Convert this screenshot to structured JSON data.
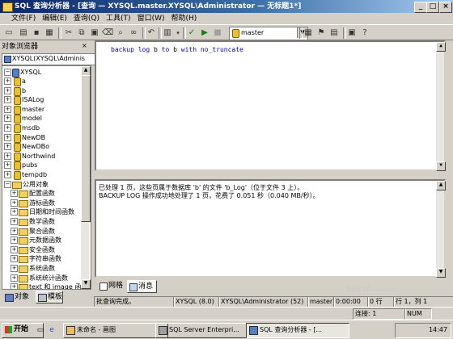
{
  "window": {
    "title": "SQL 查询分析器 - [查询 — XYSQL.master.XYSQL\\Administrator — 无标题1*]"
  },
  "menu": [
    "文件(F)",
    "编辑(E)",
    "查询(Q)",
    "工具(T)",
    "窗口(W)",
    "帮助(H)"
  ],
  "toolbar": {
    "database": "master"
  },
  "object_browser": {
    "title": "对象浏览器",
    "server_selector": "XYSQL(XYSQL\\Adminis",
    "server": "XYSQL",
    "databases": [
      "a",
      "b",
      "ISALog",
      "master",
      "model",
      "msdb",
      "NewDB",
      "NewDBo",
      "Northwind",
      "pubs",
      "tempdb"
    ],
    "functions_folder": "公用对象",
    "function_groups": [
      "配置函数",
      "游标函数",
      "日期和时间函数",
      "数学函数",
      "聚合函数",
      "元数据函数",
      "安全函数",
      "字符串函数",
      "系统函数",
      "系统统计函数",
      "text 和 image 函"
    ],
    "tabs": [
      "对象",
      "模板"
    ]
  },
  "editor": {
    "sql": "backup log b to b with no_truncate"
  },
  "results": {
    "messages": [
      "已处理 1 页，这些页属于数据库 'b' 的文件 'b_Log'（位于文件 3 上）。",
      "BACKUP LOG 操作成功地处理了 1 页，花费了 0.051 秒（0.040 MB/秒）。"
    ],
    "tabs": [
      "网格",
      "消息"
    ]
  },
  "statusbar": {
    "message": "批查询完成。",
    "server": "XYSQL (8.0)",
    "user": "XYSQL\\Administrator (52)",
    "database": "master",
    "time": "0:00:00",
    "rows": "0 行",
    "position": "行 1，列 1"
  },
  "bottom_strip": {
    "conn": "连接: 1",
    "mode": "NUM"
  },
  "taskbar": {
    "start": "开始",
    "tasks": [
      "未命名 - 画图",
      "SQL Server Enterpri...",
      "SQL 查询分析器 - [..."
    ],
    "clock": "14:47"
  },
  "watermark": "51CTO.com"
}
